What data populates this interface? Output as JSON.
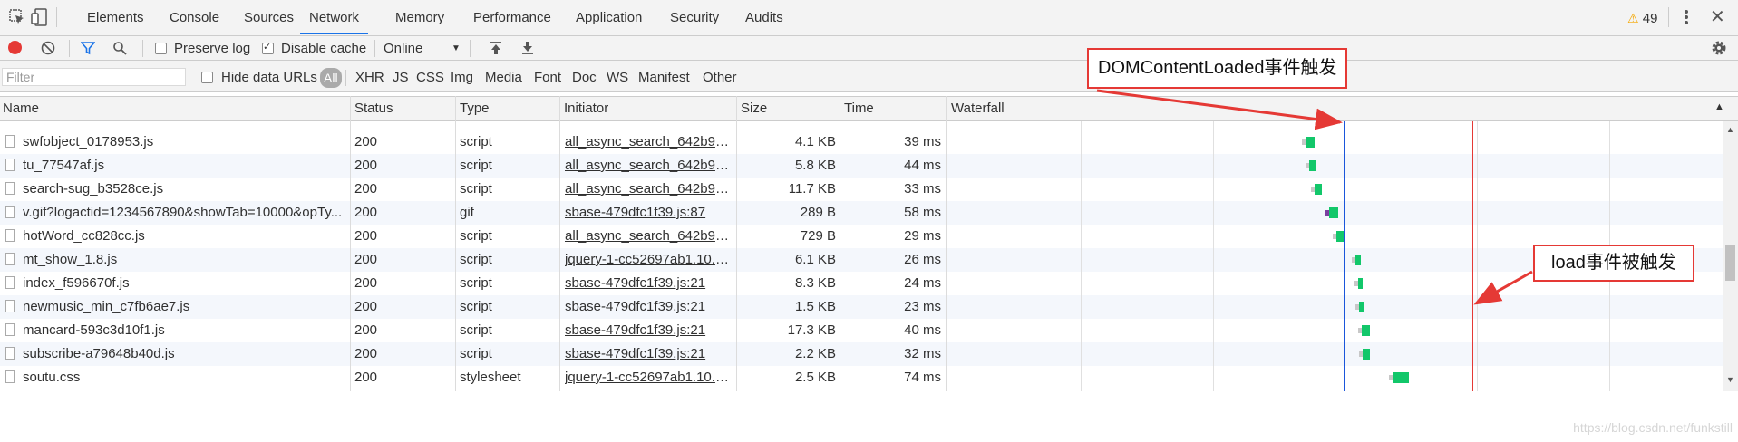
{
  "devtools": {
    "tabs": [
      "Elements",
      "Console",
      "Sources",
      "Network",
      "Memory",
      "Performance",
      "Application",
      "Security",
      "Audits"
    ],
    "active_tab": "Network",
    "warning_count": "49"
  },
  "toolbar": {
    "preserve_log_label": "Preserve log",
    "preserve_log_checked": false,
    "disable_cache_label": "Disable cache",
    "disable_cache_checked": true,
    "throttling_value": "Online"
  },
  "filterbar": {
    "filter_placeholder": "Filter",
    "hide_data_urls_label": "Hide data URLs",
    "types": [
      "All",
      "XHR",
      "JS",
      "CSS",
      "Img",
      "Media",
      "Font",
      "Doc",
      "WS",
      "Manifest",
      "Other"
    ]
  },
  "table": {
    "columns": [
      "Name",
      "Status",
      "Type",
      "Initiator",
      "Size",
      "Time",
      "Waterfall"
    ],
    "rows": [
      {
        "name": "swfobject_0178953.js",
        "status": "200",
        "type": "script",
        "initiator": "all_async_search_642b9f6...",
        "size": "4.1 KB",
        "time": "39 ms"
      },
      {
        "name": "tu_77547af.js",
        "status": "200",
        "type": "script",
        "initiator": "all_async_search_642b9f6...",
        "size": "5.8 KB",
        "time": "44 ms"
      },
      {
        "name": "search-sug_b3528ce.js",
        "status": "200",
        "type": "script",
        "initiator": "all_async_search_642b9f6...",
        "size": "11.7 KB",
        "time": "33 ms"
      },
      {
        "name": "v.gif?logactid=1234567890&showTab=10000&opTy...",
        "status": "200",
        "type": "gif",
        "initiator": "sbase-479dfc1f39.js:87",
        "size": "289 B",
        "time": "58 ms"
      },
      {
        "name": "hotWord_cc828cc.js",
        "status": "200",
        "type": "script",
        "initiator": "all_async_search_642b9f6...",
        "size": "729 B",
        "time": "29 ms"
      },
      {
        "name": "mt_show_1.8.js",
        "status": "200",
        "type": "script",
        "initiator": "jquery-1-cc52697ab1.10.2...",
        "size": "6.1 KB",
        "time": "26 ms"
      },
      {
        "name": "index_f596670f.js",
        "status": "200",
        "type": "script",
        "initiator": "sbase-479dfc1f39.js:21",
        "size": "8.3 KB",
        "time": "24 ms"
      },
      {
        "name": "newmusic_min_c7fb6ae7.js",
        "status": "200",
        "type": "script",
        "initiator": "sbase-479dfc1f39.js:21",
        "size": "1.5 KB",
        "time": "23 ms"
      },
      {
        "name": "mancard-593c3d10f1.js",
        "status": "200",
        "type": "script",
        "initiator": "sbase-479dfc1f39.js:21",
        "size": "17.3 KB",
        "time": "40 ms"
      },
      {
        "name": "subscribe-a79648b40d.js",
        "status": "200",
        "type": "script",
        "initiator": "sbase-479dfc1f39.js:21",
        "size": "2.2 KB",
        "time": "32 ms"
      },
      {
        "name": "soutu.css",
        "status": "200",
        "type": "stylesheet",
        "initiator": "jquery-1-cc52697ab1.10.2...",
        "size": "2.5 KB",
        "time": "74 ms"
      }
    ]
  },
  "annotations": {
    "dom_content_loaded": "DOMContentLoaded事件触发",
    "load": "load事件被触发"
  },
  "colors": {
    "dcl_line": "#1a56db",
    "load_line": "#e53935",
    "bar_green": "#12c76a",
    "record_red": "#e53935",
    "active_tab": "#1a73e8"
  },
  "watermark": "https://blog.csdn.net/funkstill"
}
